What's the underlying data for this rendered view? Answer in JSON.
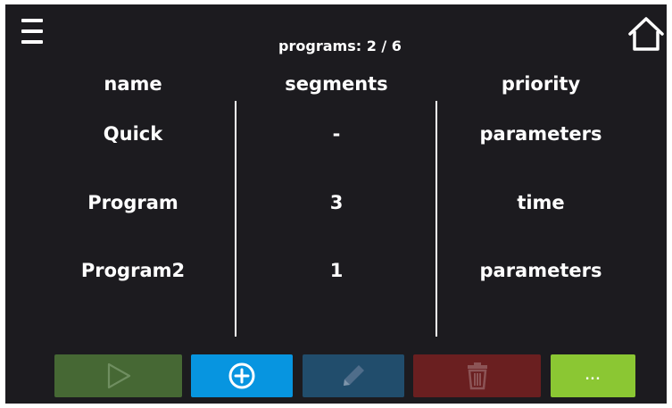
{
  "header": {
    "title": "programs: 2 / 6",
    "menu_icon": "hamburger-menu-icon",
    "home_icon": "home-icon"
  },
  "table": {
    "columns": [
      "name",
      "segments",
      "priority"
    ],
    "rows": [
      {
        "name": "Quick",
        "segments": "-",
        "priority": "parameters"
      },
      {
        "name": "Program",
        "segments": "3",
        "priority": "time"
      },
      {
        "name": "Program2",
        "segments": "1",
        "priority": "parameters"
      }
    ]
  },
  "toolbar": {
    "play_icon": "play-icon",
    "add_icon": "plus-circle-icon",
    "edit_icon": "pencil-icon",
    "delete_icon": "trash-icon",
    "more_label": "..."
  },
  "colors": {
    "background": "#1c1b1f",
    "play": "#466834",
    "add": "#0795e0",
    "edit": "#214d6c",
    "delete": "#6a1f20",
    "more": "#8bc733"
  }
}
